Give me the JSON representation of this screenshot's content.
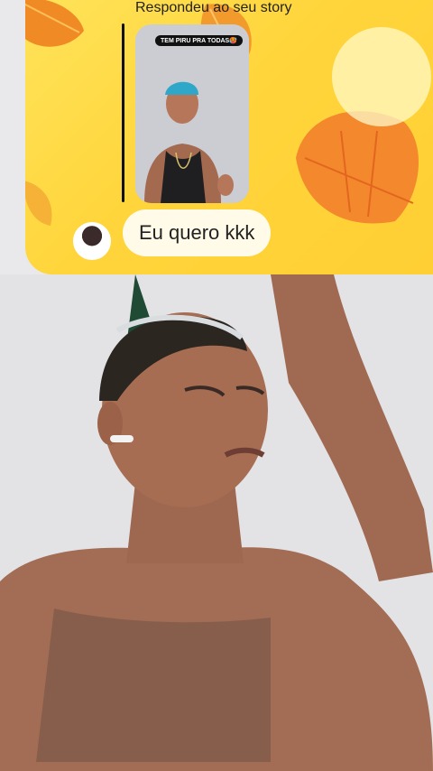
{
  "reply": {
    "label": "Respondeu ao seu story",
    "story_caption": "TEM PIRU PRA TODAS🥵",
    "message": "Eu quero kkk"
  },
  "colors": {
    "card_bg": "#ffd53b",
    "leaf": "#f29a2e",
    "bubble": "#fffbe8"
  }
}
